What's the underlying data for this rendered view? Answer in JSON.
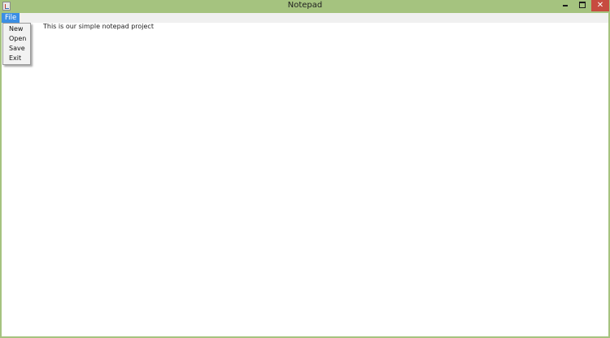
{
  "window": {
    "title": "Notepad",
    "controls": {
      "minimize": "minimize-icon",
      "maximize": "maximize-icon",
      "close": "✕"
    }
  },
  "menubar": {
    "file_label": "File"
  },
  "file_menu": {
    "items": [
      {
        "label": "New"
      },
      {
        "label": "Open"
      },
      {
        "label": "Save"
      },
      {
        "label": "Exit"
      }
    ]
  },
  "editor": {
    "text": "This is our simple notepad project"
  },
  "colors": {
    "titlebar": "#a5c37f",
    "menu_active": "#3b8ee4",
    "close_button": "#c74b40"
  }
}
